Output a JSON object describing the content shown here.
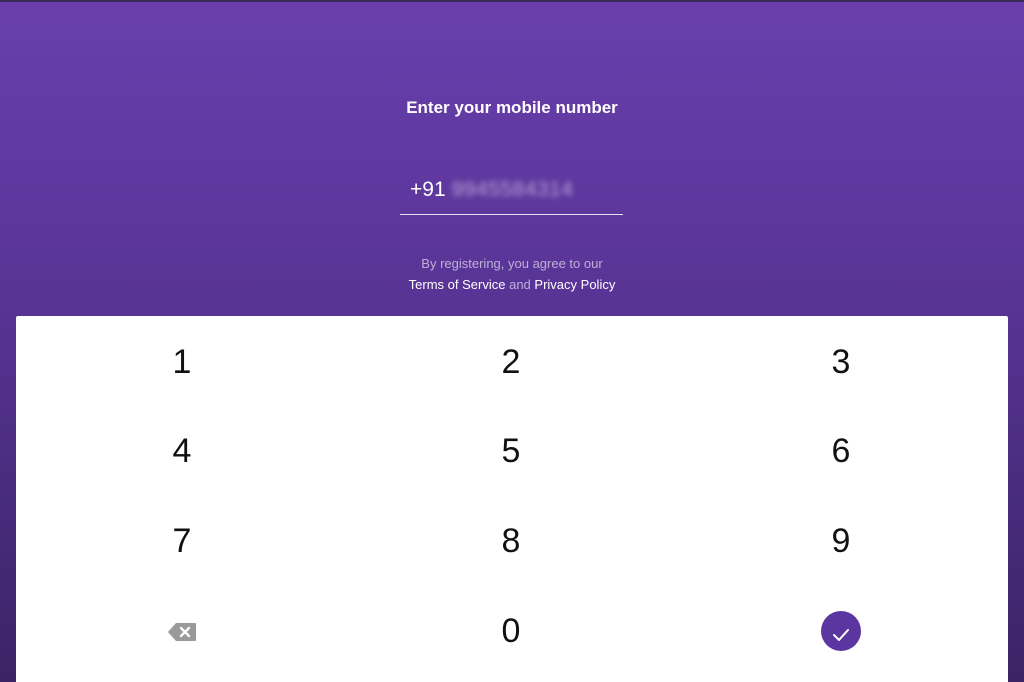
{
  "title": "Enter your mobile number",
  "phone": {
    "country_code": "+91",
    "value": "9945584314"
  },
  "terms": {
    "prefix": "By registering, you agree to our",
    "terms_link": "Terms of Service",
    "conjunction": "and",
    "privacy_link": "Privacy Policy"
  },
  "keypad": {
    "keys": [
      "1",
      "2",
      "3",
      "4",
      "5",
      "6",
      "7",
      "8",
      "9",
      "0"
    ],
    "backspace_icon": "backspace-icon",
    "submit_icon": "checkmark-icon"
  },
  "colors": {
    "accent": "#5b35a0",
    "background_top": "#6a3fad",
    "background_bottom": "#3a2466"
  }
}
